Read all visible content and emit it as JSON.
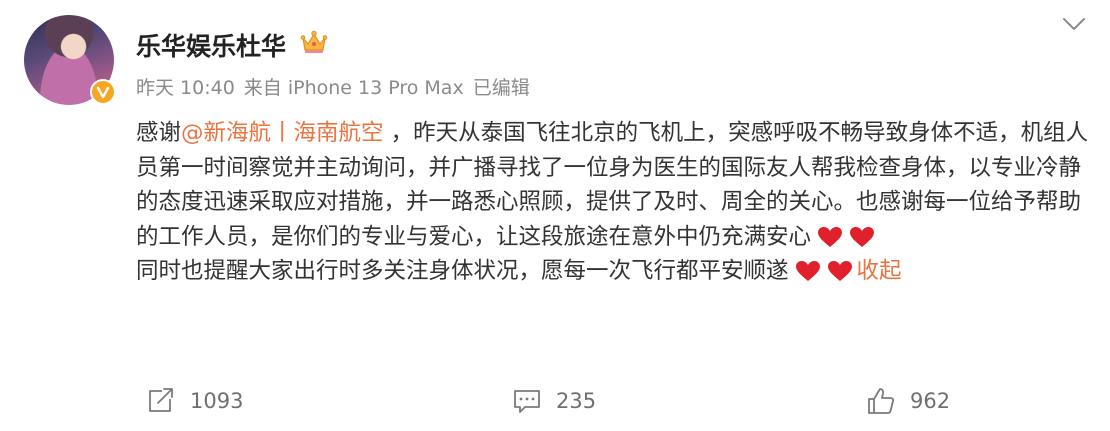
{
  "post": {
    "author": "乐华娱乐杜华",
    "meta": {
      "time": "昨天 10:40",
      "source": "来自 iPhone 13 Pro Max",
      "edited": "已编辑"
    },
    "body": {
      "p1_prefix": "感谢",
      "mention": "@新海航丨海南航空",
      "p1_text": " ，昨天从泰国飞往北京的飞机上，突感呼吸不畅导致身体不适，机组人员第一时间察觉并主动询问，并广播寻找了一位身为医生的国际友人帮我检查身体，以专业冷静的态度迅速采取应对措施，并一路悉心照顾，提供了及时、周全的关心。也感谢每一位给予帮助的工作人员，是你们的专业与爱心，让这段旅途在意外中仍充满安心",
      "p2_text": "同时也提醒大家出行时多关注身体状况，愿每一次飞行都平安顺遂",
      "collapse_label": "收起"
    },
    "stats": {
      "reposts": "1093",
      "comments": "235",
      "likes": "962"
    },
    "icons": {
      "verified": "verified-badge-icon",
      "crown": "crown-icon",
      "chevron": "chevron-down-icon",
      "heart": "red-heart-icon",
      "repost": "repost-icon",
      "comment": "comment-icon",
      "like": "thumbs-up-icon"
    },
    "colors": {
      "accent": "#eb7340",
      "verified": "#f7a623",
      "heart": "#e0202a",
      "meta_text": "#8a8a8a"
    }
  }
}
